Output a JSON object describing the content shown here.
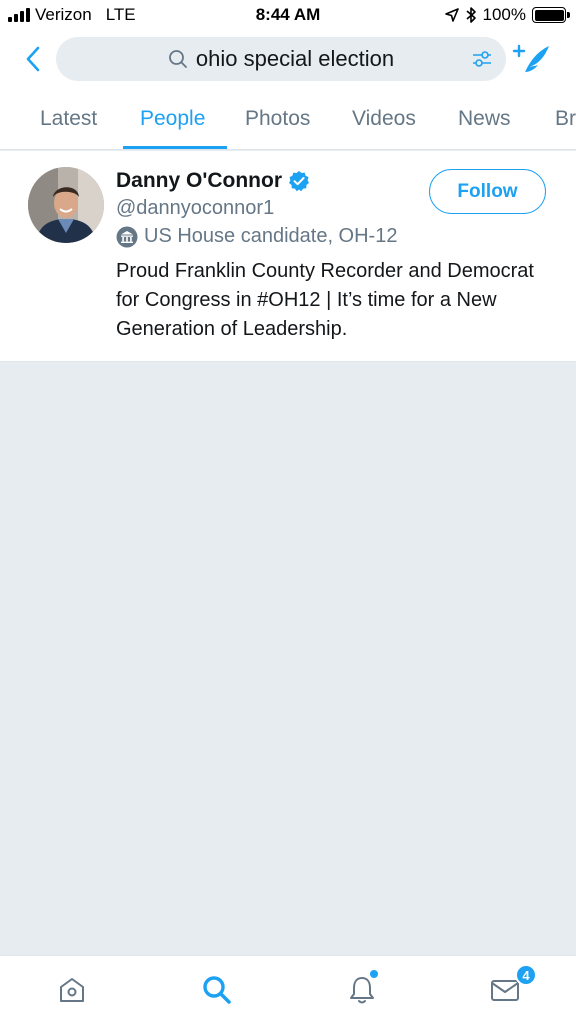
{
  "status_bar": {
    "carrier": "Verizon",
    "network": "LTE",
    "time": "8:44 AM",
    "battery": "100%",
    "battery_level": 1.0
  },
  "search": {
    "query": "ohio special election"
  },
  "tabs": [
    {
      "label": "Latest",
      "active": false
    },
    {
      "label": "People",
      "active": true
    },
    {
      "label": "Photos",
      "active": false
    },
    {
      "label": "Videos",
      "active": false
    },
    {
      "label": "News",
      "active": false
    },
    {
      "label": "Br",
      "active": false
    }
  ],
  "result": {
    "display_name": "Danny O'Connor",
    "verified": true,
    "handle": "@dannyoconnor1",
    "label": "US House candidate, OH-12",
    "bio": "Proud Franklin County Recorder and Democrat for Congress in #OH12 | It’s time for a New Generation of Leadership.",
    "follow_label": "Follow"
  },
  "tab_bar": {
    "items": [
      {
        "icon": "home-icon"
      },
      {
        "icon": "search-icon",
        "active": true
      },
      {
        "icon": "notifications-icon",
        "has_dot": true
      },
      {
        "icon": "messages-icon",
        "badge": "4"
      }
    ]
  },
  "colors": {
    "accent": "#1da1f2",
    "text_secondary": "#657786",
    "background": "#e6ecf0"
  }
}
